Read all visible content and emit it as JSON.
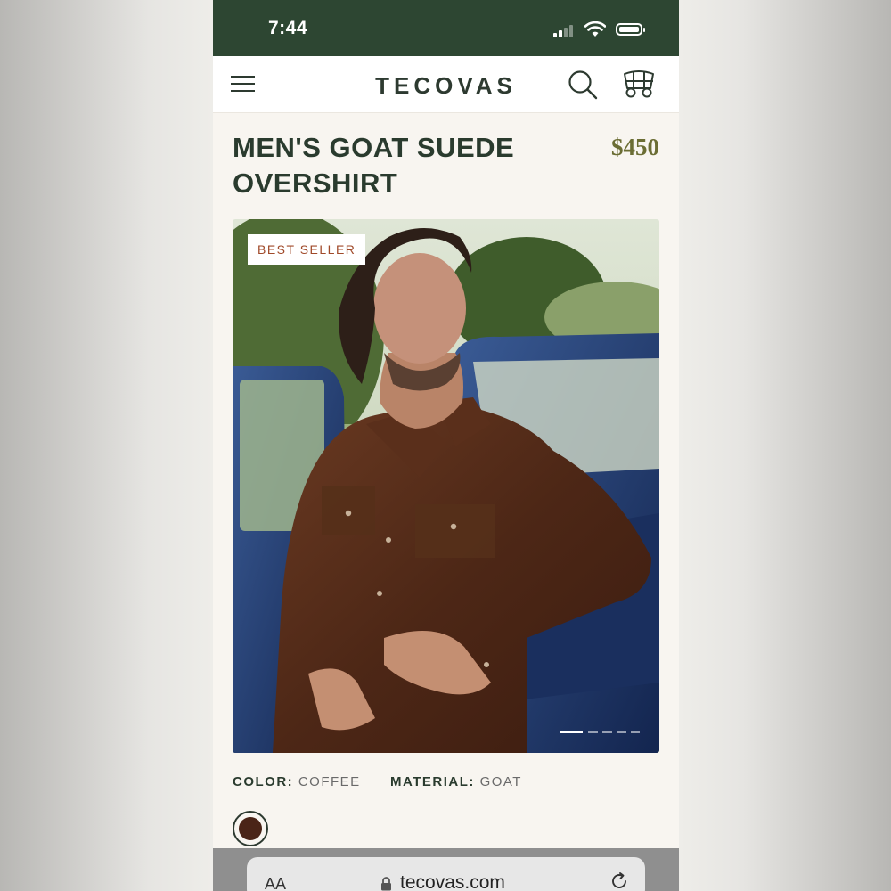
{
  "status": {
    "time": "7:44"
  },
  "nav": {
    "logo": "TECOVAS"
  },
  "product": {
    "title_line1": "MEN'S GOAT SUEDE",
    "title_line2": "OVERSHIRT",
    "price": "$450",
    "badge": "BEST SELLER",
    "carousel": {
      "total_slides": 5,
      "active_slide": 1
    },
    "color_label": "COLOR:",
    "color_value": "COFFEE",
    "material_label": "MATERIAL:",
    "material_value": "GOAT",
    "swatch_color": "#4a2417"
  },
  "browser": {
    "text_size_label": "AA",
    "url": "tecovas.com"
  },
  "colors": {
    "brand_green": "#2d4632",
    "price_olive": "#6b6d34",
    "badge_text": "#a04a2a"
  },
  "icons": [
    "menu-icon",
    "search-icon",
    "wagon-cart-icon",
    "lock-icon",
    "reload-icon",
    "signal-icon",
    "wifi-icon",
    "battery-icon"
  ]
}
